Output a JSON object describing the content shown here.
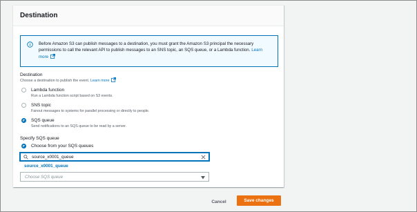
{
  "panel": {
    "title": "Destination"
  },
  "info": {
    "text": "Before Amazon S3 can publish messages to a destination, you must grant the Amazon S3 principal the necessary permissions to call the relevant API to publish messages to an SNS topic, an SQS queue, or a Lambda function.",
    "link": "Learn more"
  },
  "destination": {
    "label": "Destination",
    "description": "Choose a destination to publish the event.",
    "learn_more": "Learn more",
    "options": [
      {
        "label": "Lambda function",
        "desc": "Run a Lambda function script based on S3 events.",
        "selected": false
      },
      {
        "label": "SNS topic",
        "desc": "Fanout messages to systems for parallel processing or directly to people.",
        "selected": false
      },
      {
        "label": "SQS queue",
        "desc": "Send notifications to an SQS queue to be read by a server.",
        "selected": true
      }
    ]
  },
  "specify": {
    "label": "Specify SQS queue",
    "option_label": "Choose from your SQS queues",
    "selected": true
  },
  "search": {
    "value": "source_x0001_queue"
  },
  "dropdown": {
    "items": [
      "source_x0001_queue"
    ]
  },
  "select": {
    "placeholder": "Choose SQS queue"
  },
  "footer": {
    "cancel_label": "Cancel",
    "save_label": "Save changes"
  },
  "colors": {
    "accent": "#0073bb",
    "primary_button": "#ec7211",
    "info_bg": "#f1faff"
  }
}
